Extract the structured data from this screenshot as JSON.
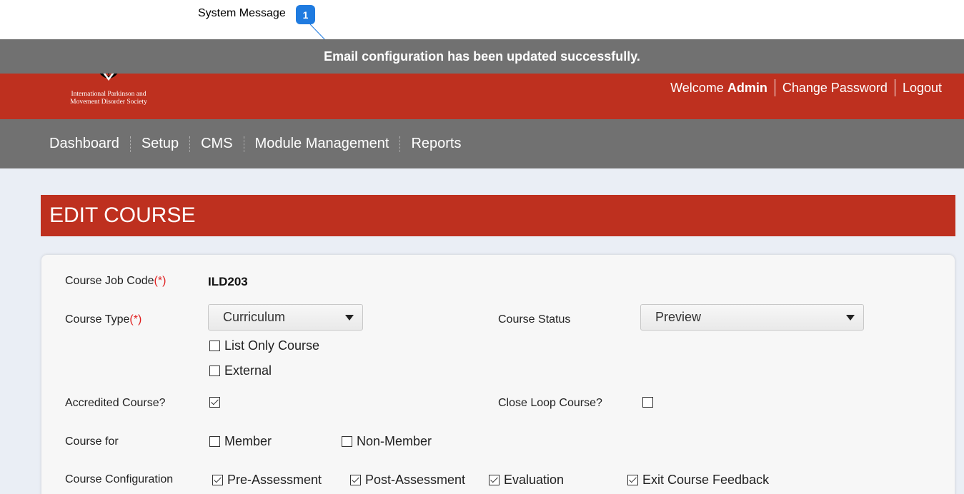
{
  "annotation": {
    "label": "System Message",
    "badge": "1"
  },
  "system_message": "Email configuration has been updated successfully.",
  "logo": {
    "line1": "International Parkinson and",
    "line2": "Movement Disorder Society"
  },
  "user_nav": {
    "welcome": "Welcome",
    "user": "Admin",
    "change_password": "Change Password",
    "logout": "Logout"
  },
  "menu": [
    "Dashboard",
    "Setup",
    "CMS",
    "Module Management",
    "Reports"
  ],
  "page_title": "EDIT COURSE",
  "form": {
    "required_marker": "(*)",
    "job_code": {
      "label": "Course Job Code",
      "value": "ILD203"
    },
    "course_type": {
      "label": "Course Type",
      "value": "Curriculum"
    },
    "list_only": {
      "label": "List Only Course",
      "checked": false
    },
    "external": {
      "label": "External",
      "checked": false
    },
    "course_status": {
      "label": "Course Status",
      "value": "Preview"
    },
    "accredited": {
      "label": "Accredited Course?",
      "checked": true
    },
    "close_loop": {
      "label": "Close Loop Course?",
      "checked": false
    },
    "course_for": {
      "label": "Course for",
      "member": "Member",
      "non_member": "Non-Member"
    },
    "configuration": {
      "label": "Course Configuration",
      "pre_assessment": "Pre-Assessment",
      "post_assessment": "Post-Assessment",
      "evaluation": "Evaluation",
      "exit_feedback": "Exit Course Feedback"
    }
  }
}
